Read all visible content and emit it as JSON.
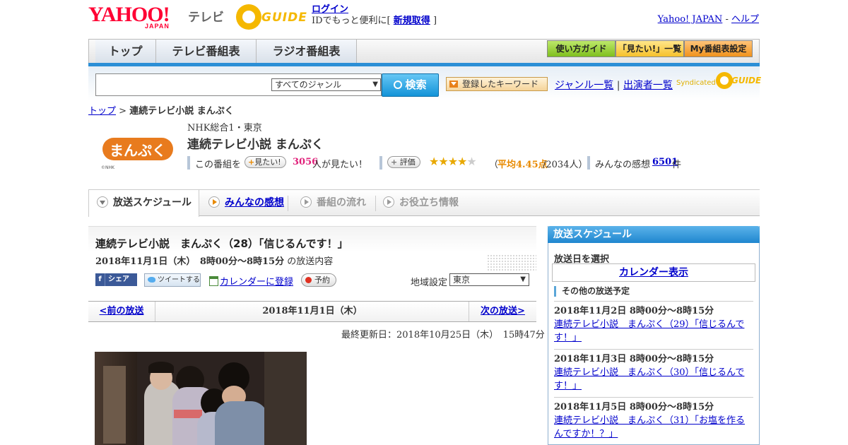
{
  "header": {
    "logo_yahoo": "YAHOO!",
    "logo_japan": "JAPAN",
    "tv": "テレビ",
    "gguide": "GUIDE",
    "login": "ログイン",
    "login_sub": "IDでもっと便利に[",
    "register": "新規取得",
    "login_close": "]",
    "yahoo_japan": "Yahoo! JAPAN",
    "sep": "-",
    "help": "ヘルプ"
  },
  "nav": {
    "tabs": [
      "トップ",
      "テレビ番組表",
      "ラジオ番組表"
    ],
    "guide": "使い方ガイド",
    "watchlist": "「見たい!」一覧",
    "my_settings": "My番組表設定"
  },
  "search": {
    "genre_selected": "すべてのジャンル",
    "button": "検索",
    "keyword_button": "登録したキーワード",
    "genre_list": "ジャンル一覧",
    "divider": "|",
    "cast_list": "出演者一覧",
    "syndicated": "Syndicated"
  },
  "breadcrumb": {
    "top": "トップ",
    "sep": ">",
    "current": "連続テレビ小説 まんぷく"
  },
  "program": {
    "logo_text": "まんぷく",
    "logo_credit": "©NHK",
    "channel": "NHK総合1・東京",
    "title": "連続テレビ小説 まんぷく",
    "this_program": "この番組を",
    "want_button": "見たい!",
    "want_count": "3056",
    "want_suffix": "人が見たい！",
    "rate_button": "評価",
    "rating": 4.45,
    "rating_open": "（",
    "rating_avg": "平均4.45点",
    "rating_people": "/2034人）",
    "comments_label": "みんなの感想",
    "comments_count": "6501",
    "comments_suffix": "件"
  },
  "tabs": {
    "schedule": "放送スケジュール",
    "comments": "みんなの感想",
    "flow": "番組の流れ",
    "info": "お役立ち情報"
  },
  "episode": {
    "title": "連続テレビ小説　まんぷく（28）「信じるんです！」",
    "date_time": "2018年11月1日（木）　8時00分～8時15分",
    "suffix": "の放送内容",
    "share": "シェア",
    "tweet": "ツイートする",
    "calendar": "カレンダーに登録",
    "reserve": "予約",
    "region_label": "地域設定",
    "region_value": "東京",
    "prev": "<前の放送",
    "date": "2018年11月1日（木）",
    "next": "次の放送>",
    "updated": "最終更新日：2018年10月25日（木）　15時47分"
  },
  "sidebar": {
    "title": "放送スケジュール",
    "select_day": "放送日を選択",
    "calendar": "カレンダー表示",
    "other": "その他の放送予定",
    "items": [
      {
        "time": "2018年11月2日  8時00分～8時15分",
        "title": "連続テレビ小説　まんぷく（29）「信じるんです！」"
      },
      {
        "time": "2018年11月3日  8時00分～8時15分",
        "title": "連続テレビ小説　まんぷく（30）「信じるんです！」"
      },
      {
        "time": "2018年11月5日  8時00分～8時15分",
        "title": "連続テレビ小説　まんぷく（31）「お塩を作るんですか！？」"
      }
    ]
  },
  "colors": {
    "accent_blue": "#2b8fd6",
    "brand_red": "#ff0033",
    "gguide_yellow": "#f5b800",
    "want_pink": "#e0207a",
    "rating_orange": "#e88a00"
  }
}
